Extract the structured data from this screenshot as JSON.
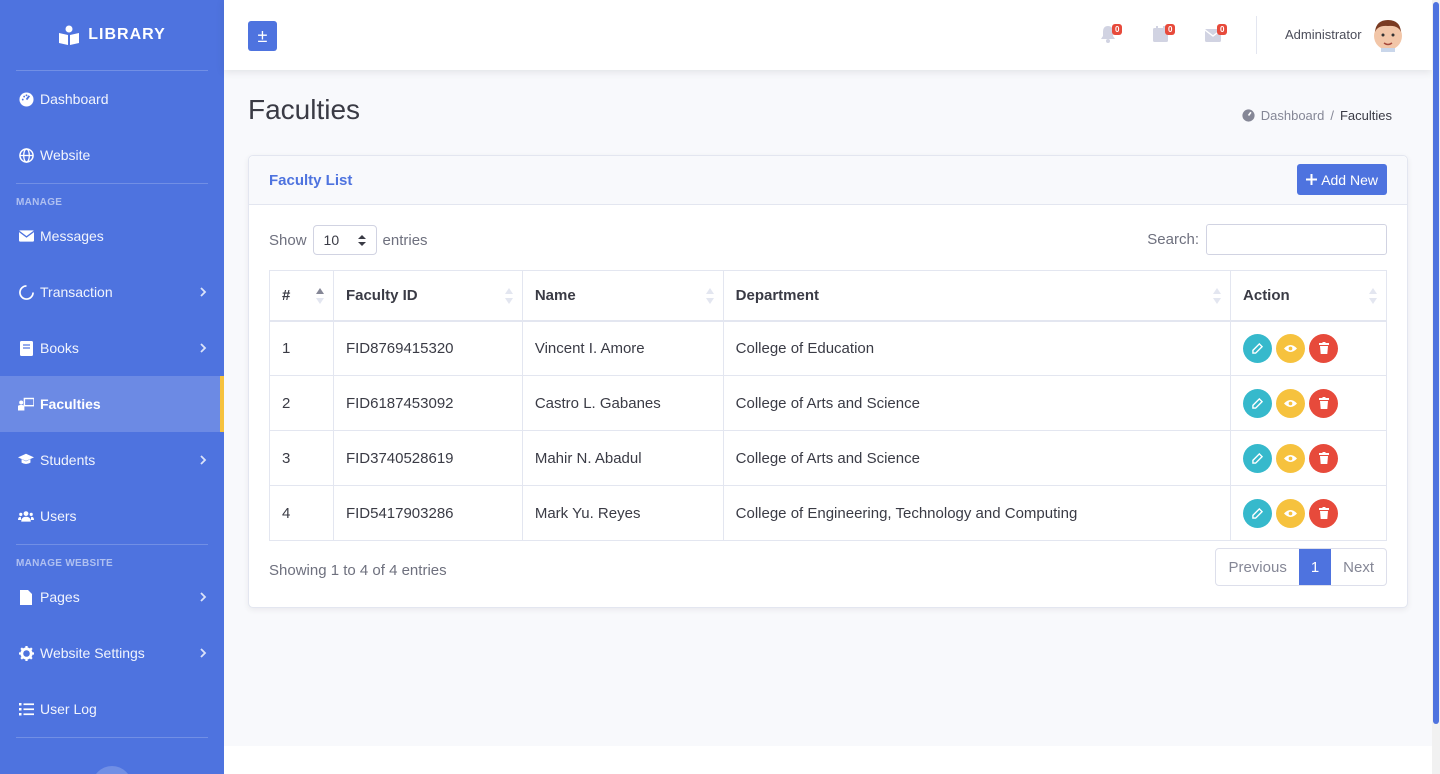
{
  "brand": {
    "name": "LIBRARY"
  },
  "sidebar": {
    "items_top": [
      {
        "label": "Dashboard",
        "icon": "dashboard-icon"
      },
      {
        "label": "Website",
        "icon": "globe-icon"
      }
    ],
    "section_manage": "MANAGE",
    "items_manage": [
      {
        "label": "Messages",
        "icon": "envelope-icon",
        "chevron": false
      },
      {
        "label": "Transaction",
        "icon": "circle-icon",
        "chevron": true
      },
      {
        "label": "Books",
        "icon": "book-icon",
        "chevron": true
      },
      {
        "label": "Faculties",
        "icon": "chalkboard-teacher-icon",
        "chevron": false,
        "active": true
      },
      {
        "label": "Students",
        "icon": "graduation-cap-icon",
        "chevron": true
      },
      {
        "label": "Users",
        "icon": "users-icon",
        "chevron": false
      }
    ],
    "section_website": "MANAGE WEBSITE",
    "items_website": [
      {
        "label": "Pages",
        "icon": "file-icon",
        "chevron": true
      },
      {
        "label": "Website Settings",
        "icon": "gear-icon",
        "chevron": true
      },
      {
        "label": "User Log",
        "icon": "list-icon",
        "chevron": false
      }
    ]
  },
  "topbar": {
    "toggle_symbol": "±",
    "alerts_count": "0",
    "calendar_count": "0",
    "messages_count": "0",
    "user_name": "Administrator"
  },
  "page": {
    "title": "Faculties",
    "breadcrumb_home": "Dashboard",
    "breadcrumb_sep": "/",
    "breadcrumb_current": "Faculties"
  },
  "card": {
    "title": "Faculty List",
    "add_label": "Add New",
    "show_label": "Show",
    "entries_value": "10",
    "entries_label": "entries",
    "search_label": "Search:",
    "search_value": ""
  },
  "table": {
    "headers": [
      "#",
      "Faculty ID",
      "Name",
      "Department",
      "Action"
    ],
    "rows": [
      {
        "num": "1",
        "id": "FID8769415320",
        "name": "Vincent I. Amore",
        "dept": "College of Education"
      },
      {
        "num": "2",
        "id": "FID6187453092",
        "name": "Castro L. Gabanes",
        "dept": "College of Arts and Science"
      },
      {
        "num": "3",
        "id": "FID3740528619",
        "name": "Mahir N. Abadul",
        "dept": "College of Arts and Science"
      },
      {
        "num": "4",
        "id": "FID5417903286",
        "name": "Mark Yu. Reyes",
        "dept": "College of Engineering, Technology and Computing"
      }
    ]
  },
  "footer_info": "Showing 1 to 4 of 4 entries",
  "pagination": {
    "previous": "Previous",
    "current": "1",
    "next": "Next"
  },
  "colors": {
    "primary": "#4e73df",
    "info": "#36b9cc",
    "warning": "#f6c23e",
    "danger": "#e74a3b"
  }
}
